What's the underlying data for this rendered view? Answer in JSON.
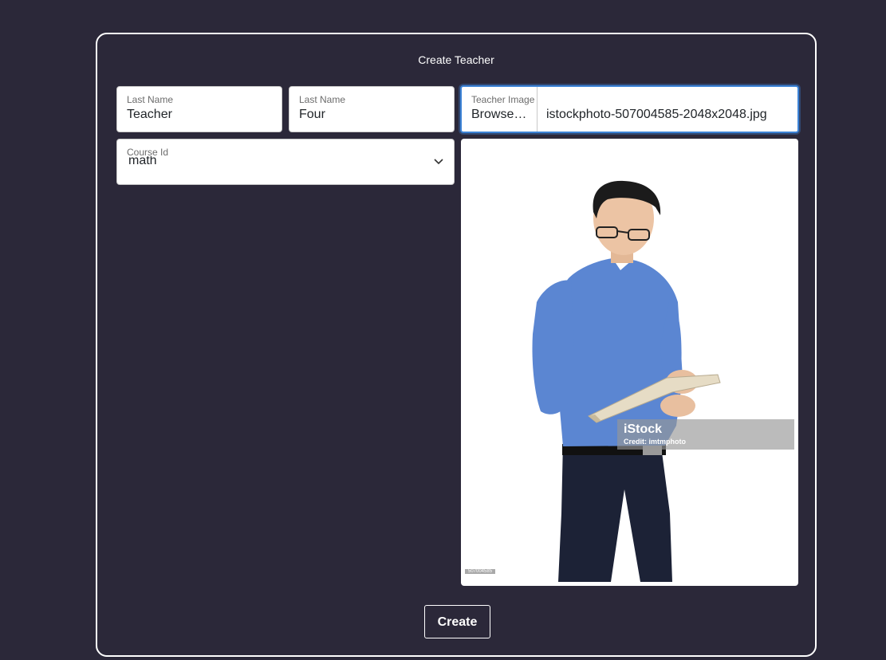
{
  "form": {
    "title": "Create Teacher",
    "last_name_1": {
      "label": "Last Name",
      "value": "Teacher"
    },
    "last_name_2": {
      "label": "Last Name",
      "value": "Four"
    },
    "teacher_image": {
      "label": "Teacher Image",
      "browse_label": "Browse…",
      "file_name": "istockphoto-507004585-2048x2048.jpg"
    },
    "course_id": {
      "label": "Course Id",
      "value": "math"
    },
    "create_label": "Create"
  },
  "preview": {
    "watermark_brand": "iStock",
    "watermark_credit": "Credit: imtmphoto",
    "photo_id": "507004585"
  },
  "colors": {
    "background": "#2b2839",
    "accent": "#3b82d6"
  }
}
